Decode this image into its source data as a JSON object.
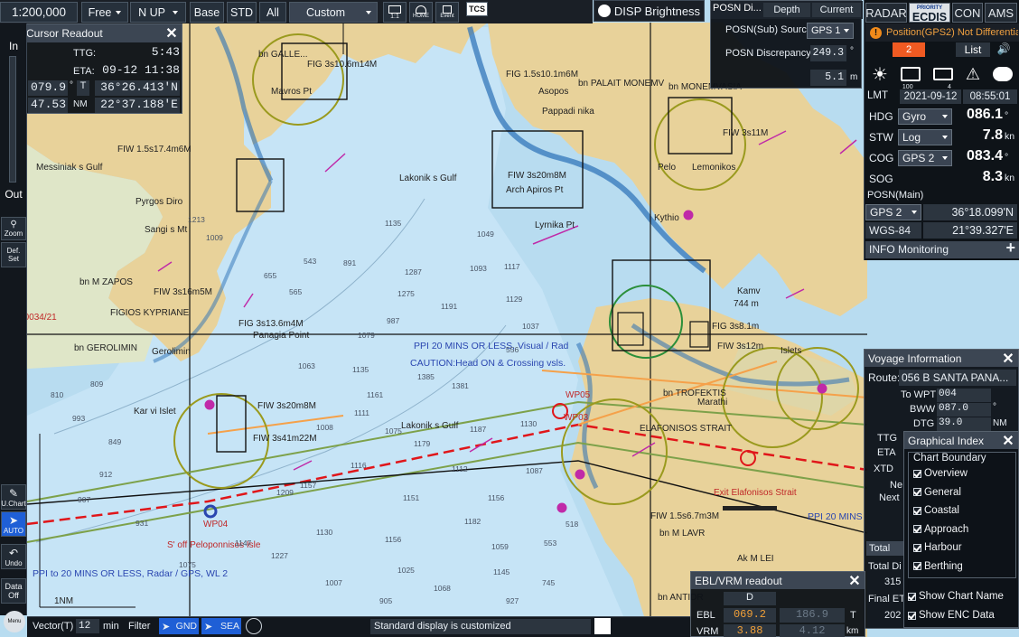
{
  "toolbar": {
    "scale": "1:200,000",
    "motion": "Free",
    "orientation": "N UP",
    "base": "Base",
    "std": "STD",
    "all": "All",
    "custom": "Custom",
    "icons": [
      {
        "name": "1-to-1-icon",
        "label": "1:1"
      },
      {
        "name": "home-icon",
        "label": "HOME"
      },
      {
        "name": "event-icon",
        "label": "Event"
      }
    ],
    "tcs": "TCS",
    "disp_brightness": "DISP Brightness"
  },
  "posn_disc": {
    "title": "POSN Di...",
    "depth": "Depth",
    "current": "Current",
    "source_label": "POSN(Sub) Source",
    "source_value": "GPS 1",
    "discrepancy_label": "POSN Discrepancy",
    "discrepancy_value": "249.3",
    "discrepancy_unit": "°",
    "distance_value": "5.1",
    "distance_unit": "m"
  },
  "mode_tabs": [
    "RADAR",
    "ECDIS",
    "CON",
    "AMS"
  ],
  "ecdis_badge": "PRIORITY",
  "alert": {
    "text": "Position(GPS2) Not Differential",
    "count": "2",
    "list": "List"
  },
  "ownship": {
    "lmt_label": "LMT",
    "date": "2021-09-12",
    "time": "08:55:01",
    "rows": [
      {
        "label": "HDG",
        "src": "Gyro",
        "val": "086.1",
        "unit": "°"
      },
      {
        "label": "STW",
        "src": "Log",
        "val": "7.8",
        "unit": "kn"
      },
      {
        "label": "COG",
        "src": "GPS 2",
        "val": "083.4",
        "unit": "°"
      },
      {
        "label": "SOG",
        "src": "",
        "val": "8.3",
        "unit": "kn"
      }
    ],
    "posn_main": "POSN(Main)",
    "gps": "GPS 2",
    "lat": "36°18.099'N",
    "datum": "WGS-84",
    "lon": "21°39.327'E"
  },
  "status_icons": [
    {
      "name": "brightness-icon",
      "sub": ""
    },
    {
      "name": "monitor-icon",
      "sub": "100"
    },
    {
      "name": "keyboard-icon",
      "sub": "4"
    },
    {
      "name": "alarm-icon",
      "sub": ""
    },
    {
      "name": "chat-icon",
      "sub": ""
    }
  ],
  "info_monitoring": "INFO Monitoring",
  "cursor_readout": {
    "title": "Cursor Readout",
    "ttg_label": "TTG:",
    "ttg": "5:43",
    "eta_label": "ETA:",
    "eta": "09-12 11:38",
    "brg": "079.9",
    "brg_unit": "°",
    "brg_mode": "T",
    "rng": "47.53",
    "rng_unit": "NM",
    "lat": "36°26.413'N",
    "lon": "22°37.188'E"
  },
  "voyage": {
    "title": "Voyage Information",
    "route_label": "Route:",
    "route": "056 B SANTA PANA...",
    "to_wpt_label": "To WPT",
    "to_wpt": "004",
    "bww_label": "BWW",
    "bww": "087.0",
    "bww_unit": "°",
    "dtg_label": "DTG",
    "dtg": "39.0",
    "dtg_unit": "NM",
    "ttg": "TTG",
    "eta": "ETA",
    "xtd": "XTD",
    "ne": "Ne",
    "next": "Next",
    "total": "Total",
    "total_di": "Total Di",
    "v315": "315",
    "final": "Final ET",
    "v202": "202"
  },
  "graphical_index": {
    "title": "Graphical Index",
    "group": "Chart Boundary",
    "items": [
      "Overview",
      "General",
      "Coastal",
      "Approach",
      "Harbour",
      "Berthing"
    ],
    "show_chart_name": "Show Chart Name",
    "show_enc": "Show ENC Data"
  },
  "ebl_vrm": {
    "title": "EBL/VRM readout",
    "col": "D",
    "ebl_label": "EBL",
    "ebl1": "069.2",
    "ebl2": "186.9",
    "ebl_unit": "T",
    "vrm_label": "VRM",
    "vrm1": "3.88",
    "vrm2": "4.12",
    "vrm_unit": "km"
  },
  "bottom": {
    "vector_label": "Vector(T)",
    "vector_val": "12",
    "vector_unit": "min",
    "filter": "Filter",
    "gnd": "GND",
    "sea": "SEA",
    "status": "Standard display is customized"
  },
  "left": {
    "in": "In",
    "out": "Out",
    "zoom": "Zoom",
    "def_set": "Def. Set",
    "lchart": "U.Chart",
    "auto": "AUTO",
    "undo": "Undo",
    "data_off": "Data Off",
    "menu": "Menu"
  },
  "chart_labels": [
    {
      "t": "bn GALLE...",
      "c": "dark"
    },
    {
      "t": "Mavros Pt",
      "c": "dark"
    },
    {
      "t": "FIG 3s10.6m14M",
      "c": "dark"
    },
    {
      "t": "bn ELAFI",
      "c": "dark"
    },
    {
      "t": "FIG 1.5s10.1m6M",
      "c": "dark"
    },
    {
      "t": "Asopos",
      "c": "dark"
    },
    {
      "t": "Pappadi nika",
      "c": "dark"
    },
    {
      "t": "bn PALAIT MONEMV",
      "c": "dark"
    },
    {
      "t": "bn MONEMVASIA",
      "c": "dark"
    },
    {
      "t": "FIW 3s11M",
      "c": "dark"
    },
    {
      "t": "Lakonik s Gulf",
      "c": "dark"
    },
    {
      "t": "Lakonik s Gulf",
      "c": "dark"
    },
    {
      "t": "Messiniak s Gulf",
      "c": "dark"
    },
    {
      "t": "FIW 1.5s17.4m6M",
      "c": "dark"
    },
    {
      "t": "Pyrgos Diro",
      "c": "dark"
    },
    {
      "t": "Sangi s Mt",
      "c": "dark"
    },
    {
      "t": "bn M ZAPOS",
      "c": "dark"
    },
    {
      "t": "FIW 3s16m5M",
      "c": "dark"
    },
    {
      "t": "FIGIOS KYPRIANE",
      "c": "dark"
    },
    {
      "t": "FIG 3s13.6m4M",
      "c": "dark"
    },
    {
      "t": "Panagia Point",
      "c": "dark"
    },
    {
      "t": "bn GEROLIMIN",
      "c": "dark"
    },
    {
      "t": "Gerolimin",
      "c": "dark"
    },
    {
      "t": "FIW 3s20m8M",
      "c": "dark"
    },
    {
      "t": "Kar vi Islet",
      "c": "dark"
    },
    {
      "t": "FIW 3s41m22M",
      "c": "dark"
    },
    {
      "t": "Lyrnika Pt",
      "c": "dark"
    },
    {
      "t": "Lemonikos",
      "c": "dark"
    },
    {
      "t": "Kythio",
      "c": "dark"
    },
    {
      "t": "Pelo",
      "c": "dark"
    },
    {
      "t": "Kamv",
      "c": "dark"
    },
    {
      "t": "744 m",
      "c": "dark"
    },
    {
      "t": "FIG 3s8.1m",
      "c": "dark"
    },
    {
      "t": "FIW 3s12m",
      "c": "dark"
    },
    {
      "t": "bn TROFEKTIS",
      "c": "dark"
    },
    {
      "t": "ELAFONISOS STRAIT",
      "c": "dark"
    },
    {
      "t": "Exit Elafonisos Strait",
      "c": "red"
    },
    {
      "t": "WP05",
      "c": "red"
    },
    {
      "t": "WP04",
      "c": "red"
    },
    {
      "t": "WP03",
      "c": "red"
    },
    {
      "t": "S' off Peloponnisos Isle",
      "c": "red"
    },
    {
      "t": "PPI 20 MINS OR LESS, Visual / Rad",
      "c": "big"
    },
    {
      "t": "CAUTION:Head ON & Crossing vsls.",
      "c": "big"
    },
    {
      "t": "PPI to 20 MINS OR LESS, Radar / GPS, WL 2",
      "c": "big"
    },
    {
      "t": "PPI 20 MINS",
      "c": "big"
    },
    {
      "t": "Arch Apiros Pt",
      "c": "dark"
    },
    {
      "t": "FIW 3s20m8M",
      "c": "dark"
    },
    {
      "t": "bn M LAVR",
      "c": "dark"
    },
    {
      "t": "bn ANTIDR",
      "c": "dark"
    },
    {
      "t": "Ak M LEI",
      "c": "dark"
    },
    {
      "t": "Islets",
      "c": "dark"
    },
    {
      "t": "Marathi",
      "c": "dark"
    },
    {
      "t": "FIW 1.5s6.7m3M",
      "c": "dark"
    },
    {
      "t": "1NM",
      "c": "dark"
    },
    {
      "t": "NAV 0034/21",
      "c": "red"
    }
  ],
  "depths": [
    "1213",
    "1009",
    "1135",
    "1287",
    "987",
    "565",
    "543",
    "655",
    "891",
    "1049",
    "1093",
    "1129",
    "1117",
    "1191",
    "1275",
    "1385",
    "1381",
    "1161",
    "1111",
    "1008",
    "1075",
    "1187",
    "1130",
    "1179",
    "1116",
    "1112",
    "1157",
    "1151",
    "1156",
    "1087",
    "1182",
    "1156",
    "1130",
    "1227",
    "1007",
    "1025",
    "1145",
    "1059",
    "1068",
    "905",
    "927",
    "745",
    "553",
    "518",
    "556",
    "1037",
    "1079",
    "1063",
    "1135",
    "1209",
    "1147",
    "1075",
    "931",
    "907",
    "912",
    "993",
    "849",
    "809",
    "810"
  ]
}
